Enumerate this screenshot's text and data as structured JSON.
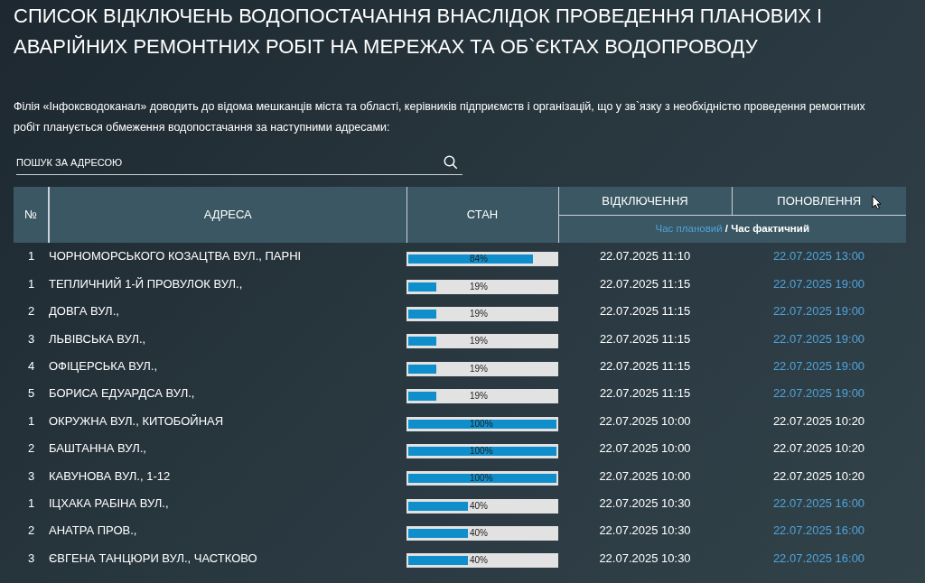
{
  "title": "СПИСОК ВІДКЛЮЧЕНЬ ВОДОПОСТАЧАННЯ ВНАСЛІДОК ПРОВЕДЕННЯ ПЛАНОВИХ І АВАРІЙНИХ РЕМОНТНИХ РОБІТ НА МЕРЕЖАХ ТА ОБ`ЄКТАХ ВОДОПРОВОДУ",
  "intro": "Філія «Інфоксводоканал» доводить до відома мешканців міста та області, керівників підприємств і організацій, що у зв`язку з необхідністю проведення ремонтних робіт планується обмеження водопостачання за наступними адресами:",
  "search": {
    "placeholder": "ПОШУК ЗА АДРЕСОЮ"
  },
  "table": {
    "columns": {
      "number": "№",
      "address": "АДРЕСА",
      "state": "СТАН",
      "off": "ВІДКЛЮЧЕННЯ",
      "update": "ПОНОВЛЕННЯ"
    },
    "legend": {
      "planned": "Час плановий",
      "separator": "/",
      "actual": "Час фактичний"
    },
    "rows": [
      {
        "number": "1",
        "address": "ЧОРНОМОРСЬКОГО КОЗАЦТВА ВУЛ., ПАРНІ",
        "level": 0.84,
        "percent": "84%",
        "off": "22.07.2025 11:10",
        "update": "22.07.2025 13:00",
        "actual_time": false
      },
      {
        "number": "1",
        "address": "ТЕПЛИЧНИЙ 1-Й ПРОВУЛОК ВУЛ.,",
        "level": 0.19,
        "percent": "19%",
        "off": "22.07.2025 11:15",
        "update": "22.07.2025 19:00",
        "actual_time": false
      },
      {
        "number": "2",
        "address": "ДОВГА ВУЛ.,",
        "level": 0.19,
        "percent": "19%",
        "off": "22.07.2025 11:15",
        "update": "22.07.2025 19:00",
        "actual_time": false
      },
      {
        "number": "3",
        "address": "ЛЬВІВСЬКА ВУЛ.,",
        "level": 0.19,
        "percent": "19%",
        "off": "22.07.2025 11:15",
        "update": "22.07.2025 19:00",
        "actual_time": false
      },
      {
        "number": "4",
        "address": "ОФІЦЕРСЬКА ВУЛ.,",
        "level": 0.19,
        "percent": "19%",
        "off": "22.07.2025 11:15",
        "update": "22.07.2025 19:00",
        "actual_time": false
      },
      {
        "number": "5",
        "address": "БОРИСА ЕДУАРДСА ВУЛ.,",
        "level": 0.19,
        "percent": "19%",
        "off": "22.07.2025 11:15",
        "update": "22.07.2025 19:00",
        "actual_time": false
      },
      {
        "number": "1",
        "address": "ОКРУЖНА ВУЛ., КИТОБОЙНАЯ",
        "level": 1,
        "percent": "100%",
        "off": "22.07.2025 10:00",
        "update": "22.07.2025 10:20",
        "actual_time": true
      },
      {
        "number": "2",
        "address": "БАШТАННА ВУЛ.,",
        "level": 1,
        "percent": "100%",
        "off": "22.07.2025 10:00",
        "update": "22.07.2025 10:20",
        "actual_time": true
      },
      {
        "number": "3",
        "address": "КАВУНОВА ВУЛ., 1-12",
        "level": 1,
        "percent": "100%",
        "off": "22.07.2025 10:00",
        "update": "22.07.2025 10:20",
        "actual_time": true
      },
      {
        "number": "1",
        "address": "ІЦХАКА РАБІНА ВУЛ.,",
        "level": 0.4,
        "percent": "40%",
        "off": "22.07.2025 10:30",
        "update": "22.07.2025 16:00",
        "actual_time": false
      },
      {
        "number": "2",
        "address": "АНАТРА ПРОВ.,",
        "level": 0.4,
        "percent": "40%",
        "off": "22.07.2025 10:30",
        "update": "22.07.2025 16:00",
        "actual_time": false
      },
      {
        "number": "3",
        "address": "ЄВГЕНА ТАНЦЮРИ ВУЛ., ЧАСТКОВО",
        "level": 0.4,
        "percent": "40%",
        "off": "22.07.2025 10:30",
        "update": "22.07.2025 16:00",
        "actual_time": false
      }
    ]
  }
}
